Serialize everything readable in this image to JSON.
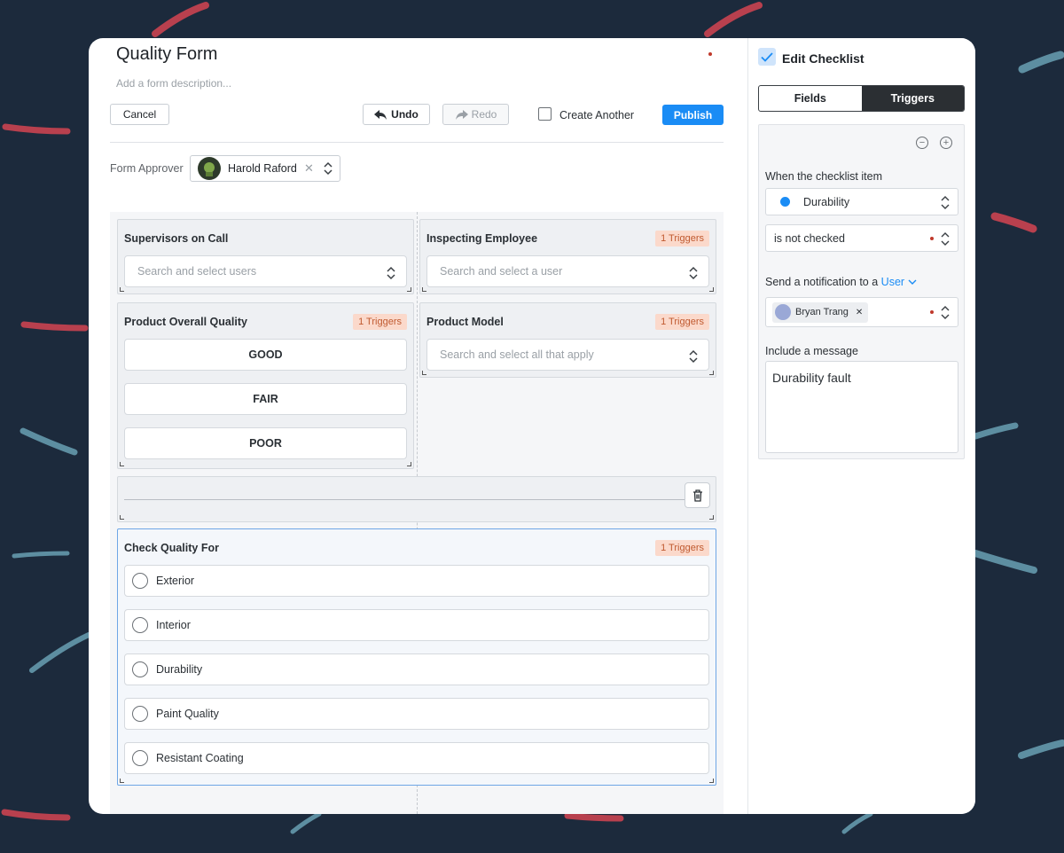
{
  "form": {
    "title": "Quality Form",
    "description_placeholder": "Add a form description...",
    "cancel_label": "Cancel",
    "undo_label": "Undo",
    "redo_label": "Redo",
    "create_another_label": "Create Another",
    "publish_label": "Publish",
    "approver_label": "Form Approver",
    "approver_name": "Harold Raford"
  },
  "fields": {
    "supervisors": {
      "label": "Supervisors on Call",
      "placeholder": "Search and select users"
    },
    "inspecting": {
      "label": "Inspecting Employee",
      "badge": "1 Triggers",
      "placeholder": "Search and select a user"
    },
    "overall": {
      "label": "Product Overall Quality",
      "badge": "1 Triggers",
      "options": [
        "GOOD",
        "FAIR",
        "POOR"
      ]
    },
    "model": {
      "label": "Product Model",
      "badge": "1 Triggers",
      "placeholder": "Search and select all that apply"
    },
    "check_quality": {
      "label": "Check Quality For",
      "badge": "1 Triggers",
      "items": [
        "Exterior",
        "Interior",
        "Durability",
        "Paint Quality",
        "Resistant Coating"
      ]
    }
  },
  "side": {
    "title": "Edit Checklist",
    "tabs": [
      "Fields",
      "Triggers"
    ],
    "active_tab": "Triggers",
    "when_label": "When the checklist item",
    "item_value": "Durability",
    "condition_value": "is not checked",
    "send_label": "Send a notification to a",
    "send_target": "User",
    "recipient": "Bryan Trang",
    "message_label": "Include a message",
    "message_value": "Durability fault"
  },
  "colors": {
    "accent": "#1a8cf5",
    "background": "#1c2a3c",
    "badge_bg": "#fbd9cb",
    "badge_text": "#c05a30"
  },
  "icons": [
    "undo-icon",
    "redo-icon",
    "chevron-updown-icon",
    "close-icon",
    "trash-icon",
    "check-icon",
    "minus-circle-icon",
    "plus-circle-icon",
    "chevron-down-icon"
  ]
}
